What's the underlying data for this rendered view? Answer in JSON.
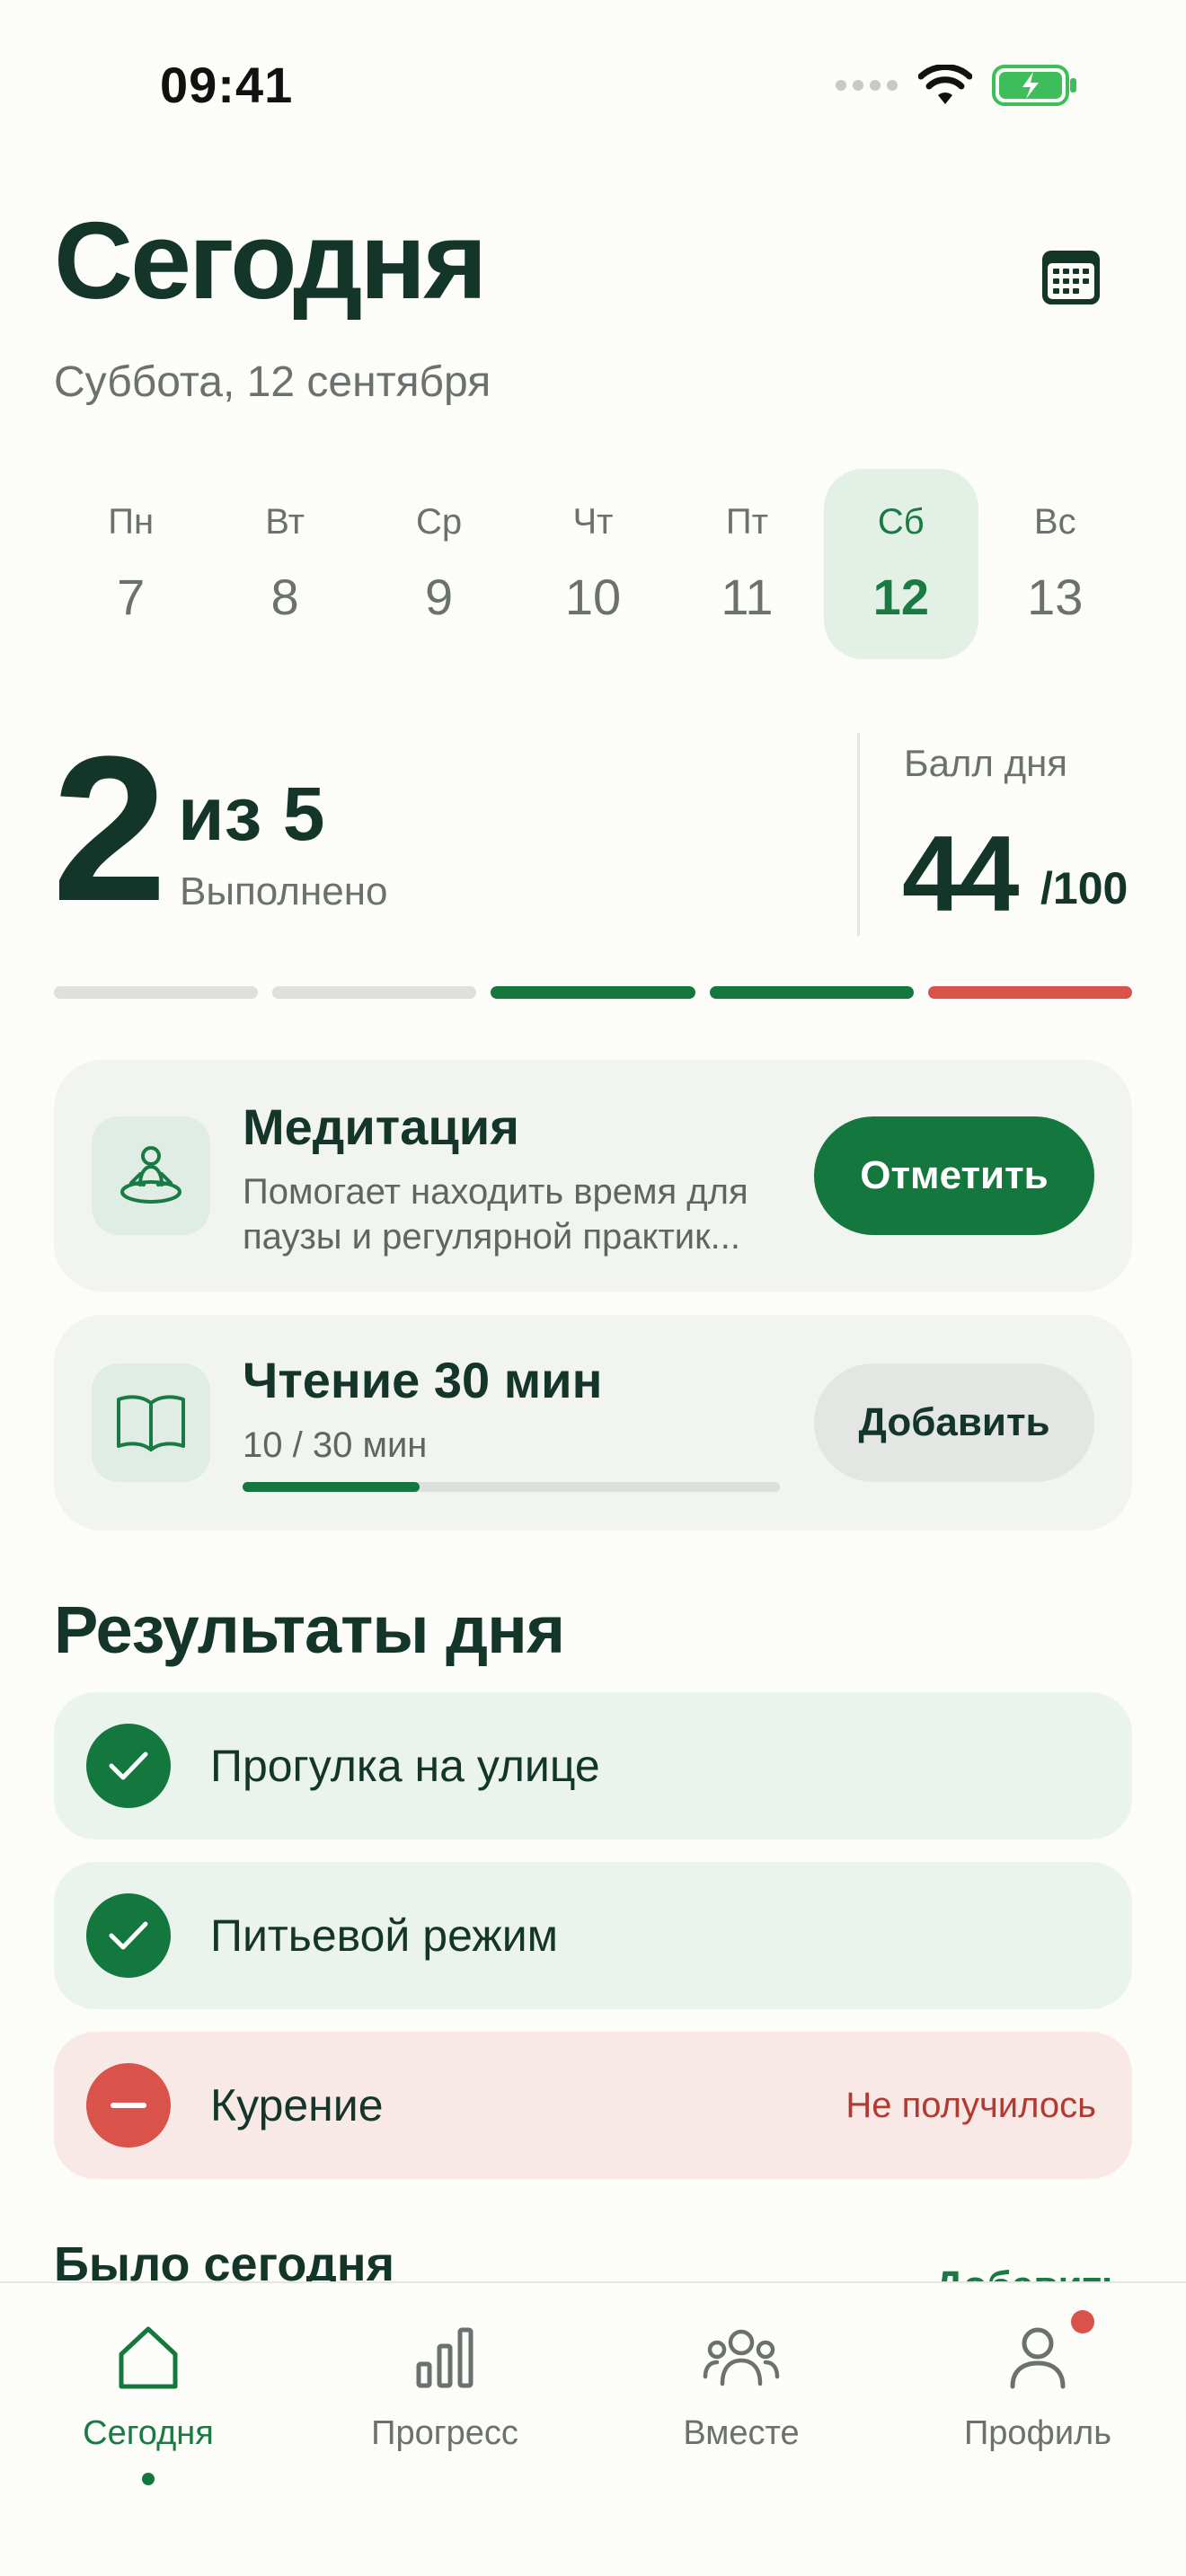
{
  "status_bar": {
    "time": "09:41"
  },
  "header": {
    "title": "Сегодня",
    "date": "Суббота, 12 сентября"
  },
  "week": [
    {
      "name": "Пн",
      "num": "7",
      "active": false
    },
    {
      "name": "Вт",
      "num": "8",
      "active": false
    },
    {
      "name": "Ср",
      "num": "9",
      "active": false
    },
    {
      "name": "Чт",
      "num": "10",
      "active": false
    },
    {
      "name": "Пт",
      "num": "11",
      "active": false
    },
    {
      "name": "Сб",
      "num": "12",
      "active": true
    },
    {
      "name": "Вс",
      "num": "13",
      "active": false
    }
  ],
  "summary": {
    "done": "2",
    "of_total": "из 5",
    "done_label": "Выполнено",
    "score_label": "Балл дня",
    "score": "44",
    "score_max": "/100",
    "segments": [
      "#DDE0DD",
      "#DDE0DD",
      "#13773E",
      "#13773E",
      "#D9534A"
    ]
  },
  "habits": [
    {
      "title": "Медитация",
      "desc": "Помогает находить время для паузы и регулярной практик...",
      "action": "Отметить",
      "icon": "meditation-icon"
    },
    {
      "title": "Чтение 30 мин",
      "progress_text": "10 / 30 мин",
      "progress": 0.33,
      "action": "Добавить",
      "icon": "book-icon"
    }
  ],
  "results": {
    "title": "Результаты дня",
    "items": [
      {
        "label": "Прогулка на улице",
        "state": "done",
        "status": ""
      },
      {
        "label": "Питьевой режим",
        "state": "done",
        "status": ""
      },
      {
        "label": "Курение",
        "state": "fail",
        "status": "Не получилось"
      }
    ]
  },
  "was_today": {
    "title": "Было сегодня",
    "link": "Добавить"
  },
  "tabs": [
    {
      "label": "Сегодня",
      "icon": "home-icon",
      "active": true
    },
    {
      "label": "Прогресс",
      "icon": "bar-chart-icon",
      "active": false
    },
    {
      "label": "Вместе",
      "icon": "people-icon",
      "active": false
    },
    {
      "label": "Профиль",
      "icon": "profile-icon",
      "active": false,
      "badge": true
    }
  ],
  "colors": {
    "accent": "#13773E",
    "danger": "#D9534A",
    "text": "#14352A",
    "muted": "#6B716E"
  }
}
